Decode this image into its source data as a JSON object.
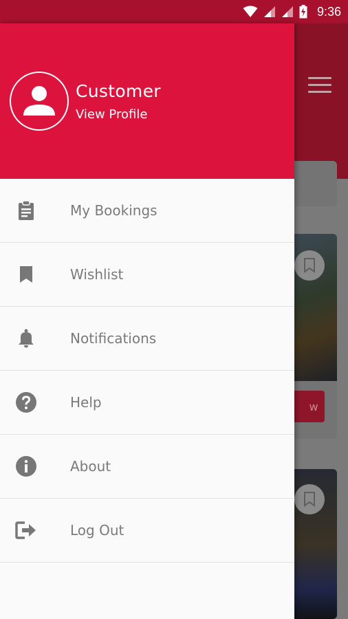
{
  "status_bar": {
    "time": "9:36",
    "icons": [
      "wifi-icon",
      "cell-signal-icon",
      "cell-signal-icon",
      "battery-charging-icon"
    ]
  },
  "background": {
    "menu_icon": "hamburger-icon",
    "card_button_fragment": "w"
  },
  "drawer": {
    "profile": {
      "name": "Customer",
      "link": "View Profile",
      "icon": "person-icon"
    },
    "items": [
      {
        "label": "My Bookings",
        "icon": "clipboard-icon"
      },
      {
        "label": "Wishlist",
        "icon": "bookmark-icon"
      },
      {
        "label": "Notifications",
        "icon": "bell-icon"
      },
      {
        "label": "Help",
        "icon": "help-circle-icon"
      },
      {
        "label": "About",
        "icon": "info-icon"
      },
      {
        "label": "Log Out",
        "icon": "logout-icon"
      }
    ]
  },
  "colors": {
    "status_bar": "#a8112d",
    "drawer_header": "#dc133d",
    "menu_text": "#7a7a7a",
    "menu_icon": "#777777"
  }
}
